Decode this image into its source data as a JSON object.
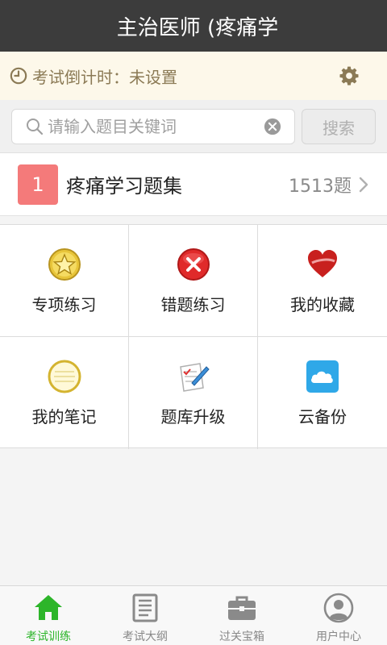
{
  "header": {
    "title": "主治医师 (疼痛学"
  },
  "countdown": {
    "label": "考试倒计时：",
    "value": "未设置",
    "icon": "clock-icon",
    "settings_icon": "gear-icon"
  },
  "search": {
    "placeholder": "请输入题目关键词",
    "button_label": "搜索"
  },
  "quiz_set": {
    "number": "1",
    "title": "疼痛学习题集",
    "count": "1513题"
  },
  "grid": [
    {
      "label": "专项练习",
      "icon": "star-badge-icon"
    },
    {
      "label": "错题练习",
      "icon": "wrong-x-icon"
    },
    {
      "label": "我的收藏",
      "icon": "heart-icon"
    },
    {
      "label": "我的笔记",
      "icon": "notebook-icon"
    },
    {
      "label": "题库升级",
      "icon": "upgrade-pen-icon"
    },
    {
      "label": "云备份",
      "icon": "cloud-icon"
    }
  ],
  "tabs": [
    {
      "label": "考试训练",
      "icon": "home-icon",
      "active": true
    },
    {
      "label": "考试大纲",
      "icon": "outline-doc-icon",
      "active": false
    },
    {
      "label": "过关宝箱",
      "icon": "briefcase-icon",
      "active": false
    },
    {
      "label": "用户中心",
      "icon": "user-icon",
      "active": false
    }
  ],
  "colors": {
    "active_tab": "#2db52a",
    "header_bg": "#3c3c3c",
    "quiz_badge": "#f47a7a"
  }
}
